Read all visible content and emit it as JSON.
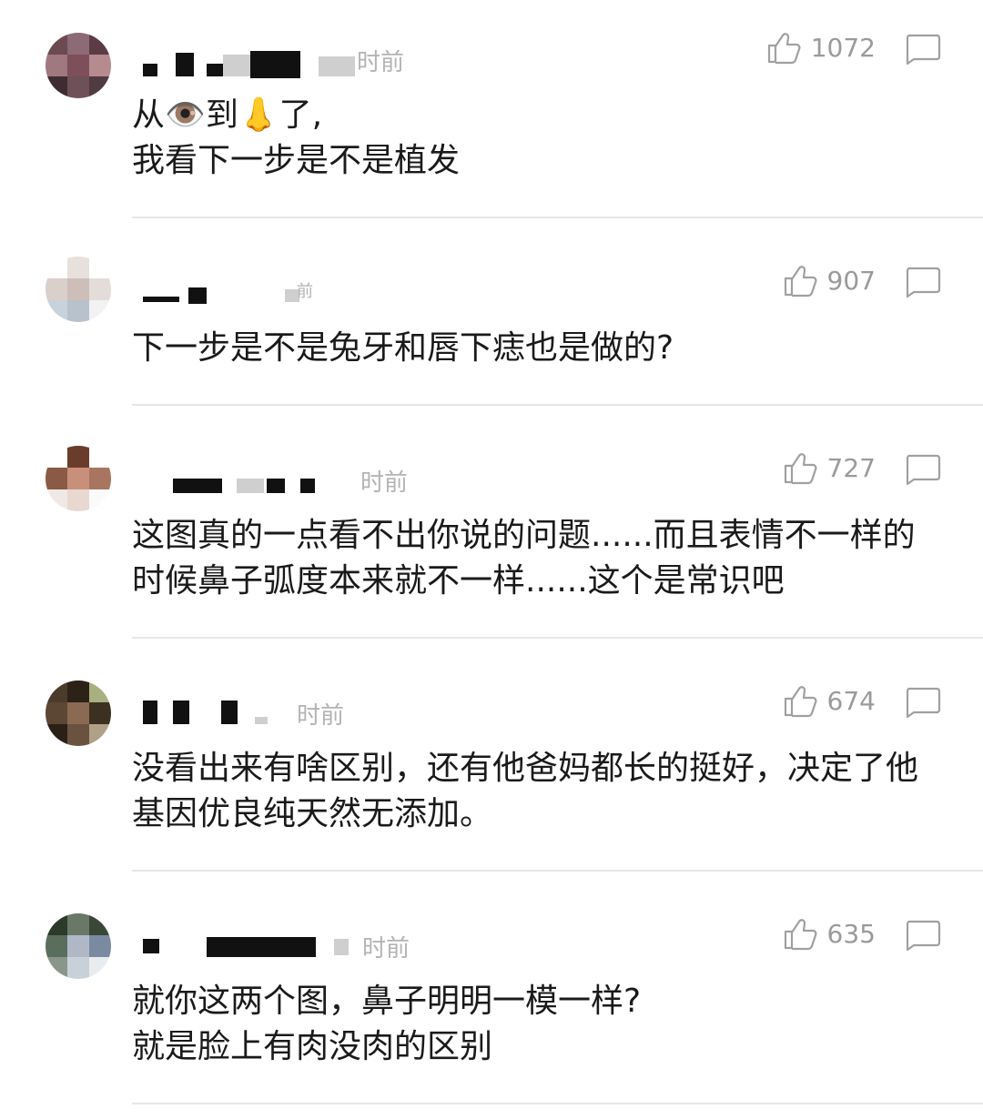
{
  "comments": [
    {
      "time": "时前",
      "likes": "1072",
      "text": "从👁️到👃了,\n我看下一步是不是植发"
    },
    {
      "time": "前",
      "likes": "907",
      "text": "下一步是不是兔牙和唇下痣也是做的?"
    },
    {
      "time": "时前",
      "likes": "727",
      "text": "这图真的一点看不出你说的问题......而且表情不一样的时候鼻子弧度本来就不一样......这个是常识吧"
    },
    {
      "time": "时前",
      "likes": "674",
      "text": "没看出来有啥区别，还有他爸妈都长的挺好，决定了他基因优良纯天然无添加。"
    },
    {
      "time": "时前",
      "likes": "635",
      "text": "就你这两个图，鼻子明明一模一样?\n就是脸上有肉没肉的区别"
    }
  ],
  "icons": {
    "like": "thumbs-up-icon",
    "reply": "comment-bubble-icon"
  },
  "colors": {
    "meta": "#9a9a9a",
    "divider": "#e6e6e6",
    "text": "#1a1a1a"
  }
}
